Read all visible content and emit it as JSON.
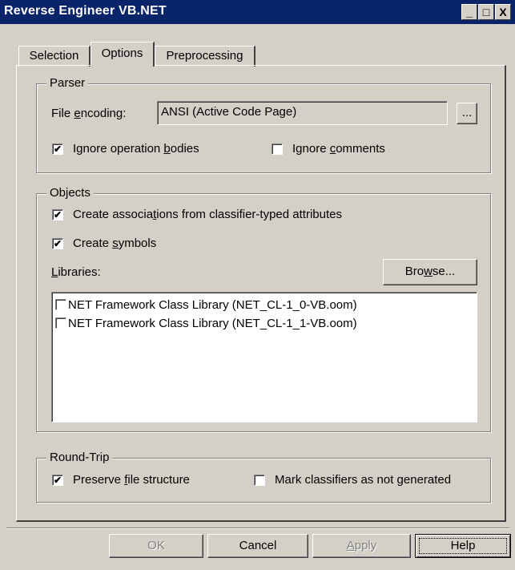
{
  "window": {
    "title": "Reverse Engineer VB.NET",
    "controls": {
      "minimize": "_",
      "maximize": "□",
      "close": "X"
    }
  },
  "tabs": [
    {
      "label": "Selection",
      "active": false
    },
    {
      "label": "Options",
      "active": true
    },
    {
      "label": "Preprocessing",
      "active": false
    }
  ],
  "parser": {
    "legend": "Parser",
    "encoding_label": "File encoding:",
    "encoding_value": "ANSI (Active Code Page)",
    "browse_small_label": "...",
    "ignore_bodies": {
      "label": "Ignore operation bodies",
      "checked": true
    },
    "ignore_comments": {
      "label": "Ignore comments",
      "checked": false
    }
  },
  "objects": {
    "legend": "Objects",
    "create_associations": {
      "label": "Create associations from classifier-typed attributes",
      "checked": true
    },
    "create_symbols": {
      "label": "Create symbols",
      "checked": true
    },
    "libraries_label": "Libraries:",
    "browse_label": "Browse...",
    "libraries": [
      {
        "label": "NET Framework Class Library (NET_CL-1_0-VB.oom)",
        "checked": false
      },
      {
        "label": "NET Framework Class Library (NET_CL-1_1-VB.oom)",
        "checked": false
      }
    ]
  },
  "roundtrip": {
    "legend": "Round-Trip",
    "preserve": {
      "label": "Preserve file structure",
      "checked": true
    },
    "mark_classifiers": {
      "label": "Mark classifiers as not generated",
      "checked": false
    }
  },
  "buttons": {
    "ok": "OK",
    "cancel": "Cancel",
    "apply": "Apply",
    "help": "Help"
  }
}
